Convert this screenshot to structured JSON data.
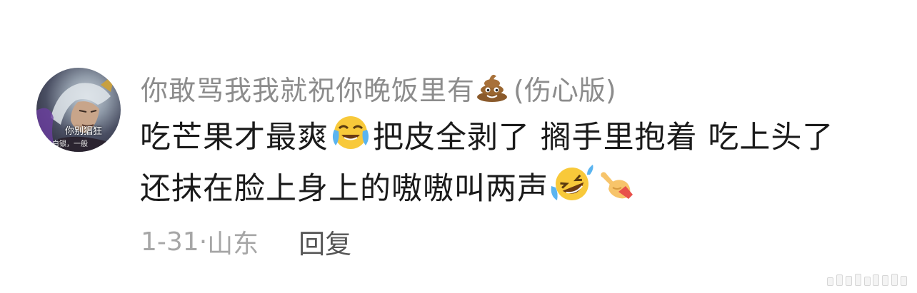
{
  "comment": {
    "username": "你敢骂我我就祝你晚饭里有",
    "username_emoji": "poop-emoji",
    "username_suffix": "(伤心版)",
    "avatar_caption": "你别猖狂",
    "avatar_caption_small": "白银，一般",
    "text_part1": "吃芒果才最爽",
    "emoji1": "crying-with-joy-face-emoji",
    "text_part2": "把皮全剥了 搁手里抱着 吃上头了还抹在脸上身上的嗷嗷叫两声",
    "emoji2": "rolling-on-floor-laughing-emoji",
    "emoji3": "pointing-hand-emoji",
    "date": "1-31",
    "separator": "·",
    "location": "山东",
    "reply_label": "回复"
  },
  "colors": {
    "username": "#8c8c8c",
    "body_text": "#1a1a1a",
    "meta": "#a6a6a6",
    "reply": "#555555"
  }
}
